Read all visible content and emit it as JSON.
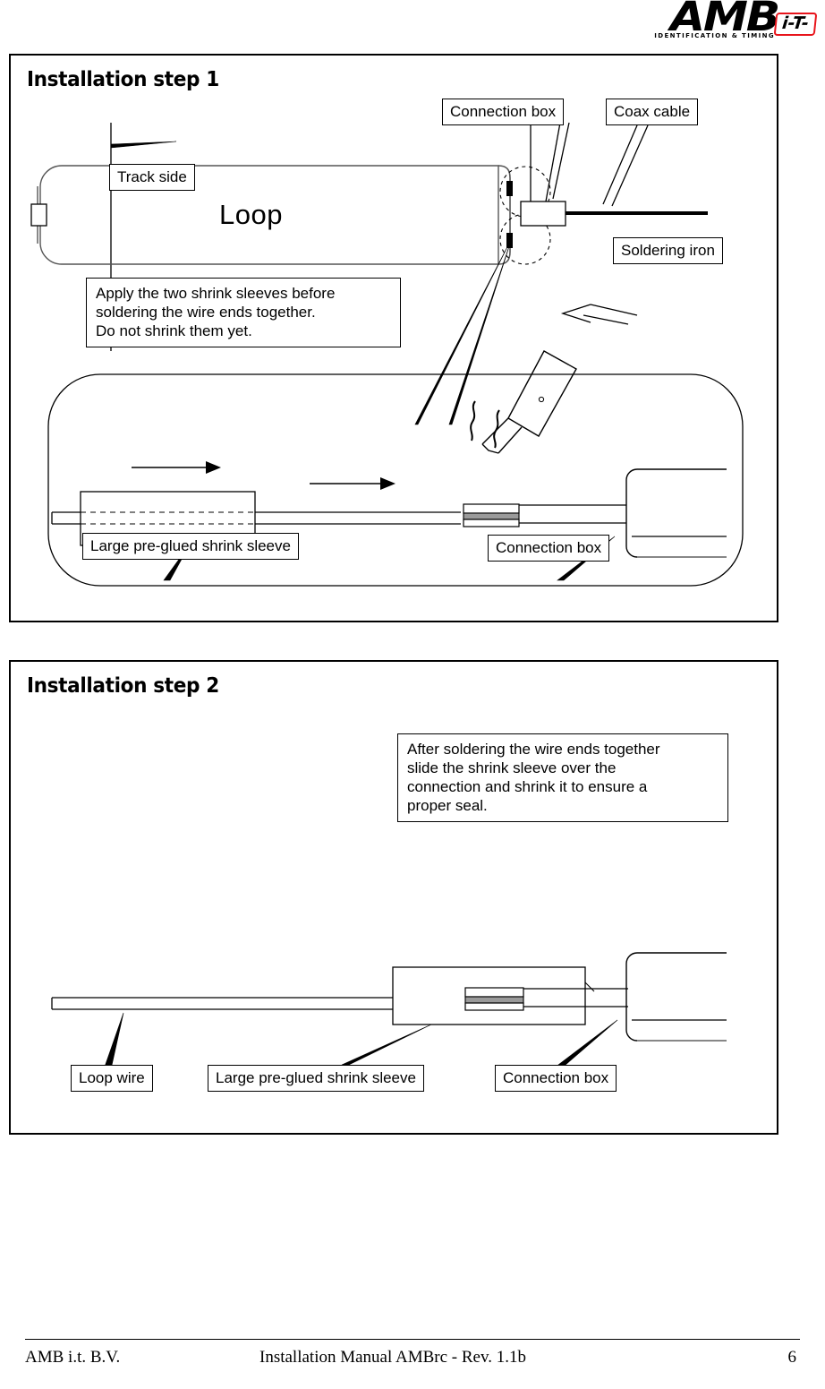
{
  "document": {
    "title": "Installation Manual AMBrc",
    "page_number": "6"
  },
  "header": {
    "logo_wordmark": "AMB",
    "logo_tagline": "IDENTIFICATION & TIMING",
    "logo_badge": "i-T-",
    "badge_color": "#e8141b"
  },
  "step1": {
    "title": "Installation step 1",
    "labels": {
      "track_side": "Track side",
      "connection_box_top": "Connection box",
      "coax_cable": "Coax cable",
      "soldering_iron": "Soldering iron",
      "loop": "Loop",
      "large_shrink_sleeve": "Large pre-glued shrink sleeve",
      "connection_box_bottom": "Connection box"
    },
    "note": {
      "line1": "Apply the two shrink sleeves before",
      "line2": "soldering the wire ends together.",
      "line3": "Do not shrink them yet."
    }
  },
  "step2": {
    "title": "Installation step 2",
    "note": {
      "line1": "After soldering the wire ends together",
      "line2": "slide the shrink sleeve over the",
      "line3": "connection and shrink it to ensure a",
      "line4": "proper seal."
    },
    "labels": {
      "loop_wire": "Loop wire",
      "large_shrink_sleeve": "Large pre-glued shrink sleeve",
      "connection_box": "Connection box"
    }
  },
  "footer": {
    "left": "AMB i.t. B.V.",
    "center": "Installation Manual AMBrc - Rev. 1.1b",
    "right": "6"
  }
}
